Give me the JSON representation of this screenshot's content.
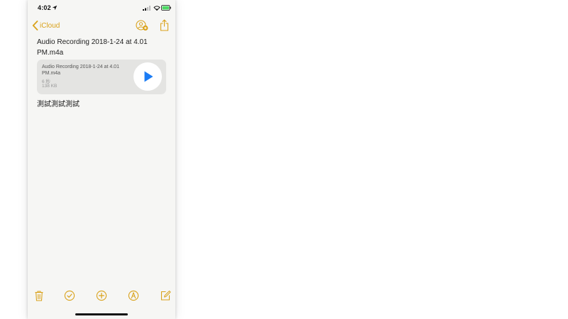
{
  "status_bar": {
    "time": "4:02"
  },
  "nav": {
    "back_label": "iCloud"
  },
  "note": {
    "title": "Audio Recording 2018-1-24 at 4.01 PM.m4a",
    "body": "測試測試測試"
  },
  "attachment": {
    "name": "Audio Recording 2018-1-24 at 4.01 PM.m4a",
    "duration": "6 秒",
    "size": "138 KB"
  },
  "colors": {
    "accent": "#d9a21b",
    "play": "#1b7cf5",
    "battery": "#4cd964",
    "note_background": "#f6f6f4",
    "attachment_background": "#e4e4e2"
  },
  "icons": {
    "location": "location-arrow-icon",
    "signal": "cellular-signal-icon",
    "wifi": "wifi-icon",
    "battery": "battery-icon",
    "back": "chevron-left-icon",
    "share_user": "add-people-icon",
    "share": "share-icon",
    "play": "play-icon",
    "trash": "trash-icon",
    "checklist": "checklist-icon",
    "add": "plus-circle-icon",
    "markup": "pen-markup-icon",
    "compose": "compose-icon"
  }
}
